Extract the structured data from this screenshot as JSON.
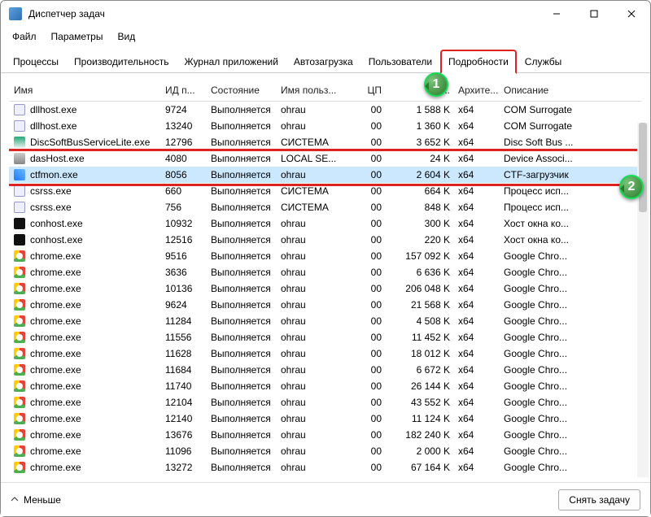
{
  "window": {
    "title": "Диспетчер задач"
  },
  "menu": {
    "file": "Файл",
    "options": "Параметры",
    "view": "Вид"
  },
  "tabs": {
    "processes": "Процессы",
    "performance": "Производительность",
    "apphistory": "Журнал приложений",
    "startup": "Автозагрузка",
    "users": "Пользователи",
    "details": "Подробности",
    "services": "Службы"
  },
  "columns": {
    "name": "Имя",
    "pid": "ИД п...",
    "status": "Состояние",
    "user": "Имя польз...",
    "cpu": "ЦП",
    "mem": "ь ...",
    "arch": "Архите...",
    "desc": "Описание"
  },
  "rows": [
    {
      "icon": "file",
      "name": "dllhost.exe",
      "pid": "9724",
      "status": "Выполняется",
      "user": "ohrau",
      "cpu": "00",
      "mem": "1 588 K",
      "arch": "x64",
      "desc": "COM Surrogate"
    },
    {
      "icon": "file",
      "name": "dllhost.exe",
      "pid": "13240",
      "status": "Выполняется",
      "user": "ohrau",
      "cpu": "00",
      "mem": "1 360 K",
      "arch": "x64",
      "desc": "COM Surrogate"
    },
    {
      "icon": "disc",
      "name": "DiscSoftBusServiceLite.exe",
      "pid": "12796",
      "status": "Выполняется",
      "user": "СИСТЕМА",
      "cpu": "00",
      "mem": "3 652 K",
      "arch": "x64",
      "desc": "Disc Soft Bus ..."
    },
    {
      "icon": "gear",
      "name": "dasHost.exe",
      "pid": "4080",
      "status": "Выполняется",
      "user": "LOCAL SE...",
      "cpu": "00",
      "mem": "24 K",
      "arch": "x64",
      "desc": "Device Associ..."
    },
    {
      "icon": "pen",
      "name": "ctfmon.exe",
      "pid": "8056",
      "status": "Выполняется",
      "user": "ohrau",
      "cpu": "00",
      "mem": "2 604 K",
      "arch": "x64",
      "desc": "CTF-загрузчик",
      "selected": true
    },
    {
      "icon": "file",
      "name": "csrss.exe",
      "pid": "660",
      "status": "Выполняется",
      "user": "СИСТЕМА",
      "cpu": "00",
      "mem": "664 K",
      "arch": "x64",
      "desc": "Процесс исп..."
    },
    {
      "icon": "file",
      "name": "csrss.exe",
      "pid": "756",
      "status": "Выполняется",
      "user": "СИСТЕМА",
      "cpu": "00",
      "mem": "848 K",
      "arch": "x64",
      "desc": "Процесс исп..."
    },
    {
      "icon": "cmd",
      "name": "conhost.exe",
      "pid": "10932",
      "status": "Выполняется",
      "user": "ohrau",
      "cpu": "00",
      "mem": "300 K",
      "arch": "x64",
      "desc": "Хост окна ко..."
    },
    {
      "icon": "cmd",
      "name": "conhost.exe",
      "pid": "12516",
      "status": "Выполняется",
      "user": "ohrau",
      "cpu": "00",
      "mem": "220 K",
      "arch": "x64",
      "desc": "Хост окна ко..."
    },
    {
      "icon": "chrome",
      "name": "chrome.exe",
      "pid": "9516",
      "status": "Выполняется",
      "user": "ohrau",
      "cpu": "00",
      "mem": "157 092 K",
      "arch": "x64",
      "desc": "Google Chro..."
    },
    {
      "icon": "chrome",
      "name": "chrome.exe",
      "pid": "3636",
      "status": "Выполняется",
      "user": "ohrau",
      "cpu": "00",
      "mem": "6 636 K",
      "arch": "x64",
      "desc": "Google Chro..."
    },
    {
      "icon": "chrome",
      "name": "chrome.exe",
      "pid": "10136",
      "status": "Выполняется",
      "user": "ohrau",
      "cpu": "00",
      "mem": "206 048 K",
      "arch": "x64",
      "desc": "Google Chro..."
    },
    {
      "icon": "chrome",
      "name": "chrome.exe",
      "pid": "9624",
      "status": "Выполняется",
      "user": "ohrau",
      "cpu": "00",
      "mem": "21 568 K",
      "arch": "x64",
      "desc": "Google Chro..."
    },
    {
      "icon": "chrome",
      "name": "chrome.exe",
      "pid": "11284",
      "status": "Выполняется",
      "user": "ohrau",
      "cpu": "00",
      "mem": "4 508 K",
      "arch": "x64",
      "desc": "Google Chro..."
    },
    {
      "icon": "chrome",
      "name": "chrome.exe",
      "pid": "11556",
      "status": "Выполняется",
      "user": "ohrau",
      "cpu": "00",
      "mem": "11 452 K",
      "arch": "x64",
      "desc": "Google Chro..."
    },
    {
      "icon": "chrome",
      "name": "chrome.exe",
      "pid": "11628",
      "status": "Выполняется",
      "user": "ohrau",
      "cpu": "00",
      "mem": "18 012 K",
      "arch": "x64",
      "desc": "Google Chro..."
    },
    {
      "icon": "chrome",
      "name": "chrome.exe",
      "pid": "11684",
      "status": "Выполняется",
      "user": "ohrau",
      "cpu": "00",
      "mem": "6 672 K",
      "arch": "x64",
      "desc": "Google Chro..."
    },
    {
      "icon": "chrome",
      "name": "chrome.exe",
      "pid": "11740",
      "status": "Выполняется",
      "user": "ohrau",
      "cpu": "00",
      "mem": "26 144 K",
      "arch": "x64",
      "desc": "Google Chro..."
    },
    {
      "icon": "chrome",
      "name": "chrome.exe",
      "pid": "12104",
      "status": "Выполняется",
      "user": "ohrau",
      "cpu": "00",
      "mem": "43 552 K",
      "arch": "x64",
      "desc": "Google Chro..."
    },
    {
      "icon": "chrome",
      "name": "chrome.exe",
      "pid": "12140",
      "status": "Выполняется",
      "user": "ohrau",
      "cpu": "00",
      "mem": "11 124 K",
      "arch": "x64",
      "desc": "Google Chro..."
    },
    {
      "icon": "chrome",
      "name": "chrome.exe",
      "pid": "13676",
      "status": "Выполняется",
      "user": "ohrau",
      "cpu": "00",
      "mem": "182 240 K",
      "arch": "x64",
      "desc": "Google Chro..."
    },
    {
      "icon": "chrome",
      "name": "chrome.exe",
      "pid": "11096",
      "status": "Выполняется",
      "user": "ohrau",
      "cpu": "00",
      "mem": "2 000 K",
      "arch": "x64",
      "desc": "Google Chro..."
    },
    {
      "icon": "chrome",
      "name": "chrome.exe",
      "pid": "13272",
      "status": "Выполняется",
      "user": "ohrau",
      "cpu": "00",
      "mem": "67 164 K",
      "arch": "x64",
      "desc": "Google Chro..."
    }
  ],
  "bottom": {
    "less": "Меньше",
    "endtask": "Снять задачу"
  },
  "callouts": {
    "one": "1",
    "two": "2"
  }
}
